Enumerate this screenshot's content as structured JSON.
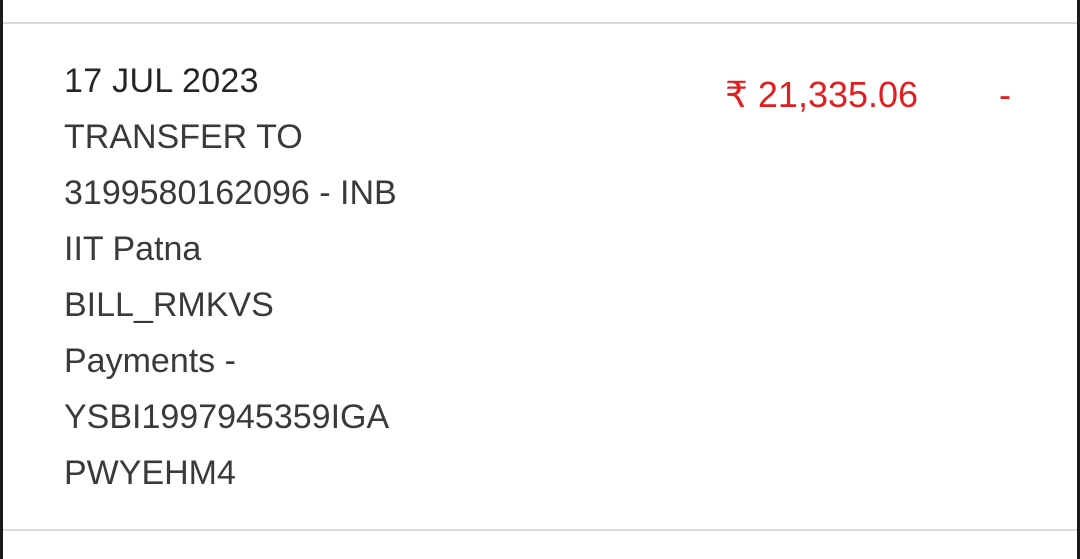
{
  "transaction": {
    "date": "17 JUL 2023",
    "description_lines": [
      "TRANSFER TO",
      "3199580162096 - INB",
      "IIT Patna",
      "BILL_RMKVS",
      "Payments -",
      "YSBI1997945359IGA",
      "PWYEHM4"
    ],
    "amount": "₹ 21,335.06",
    "amount_suffix": "-",
    "amount_color": "#e02020"
  }
}
